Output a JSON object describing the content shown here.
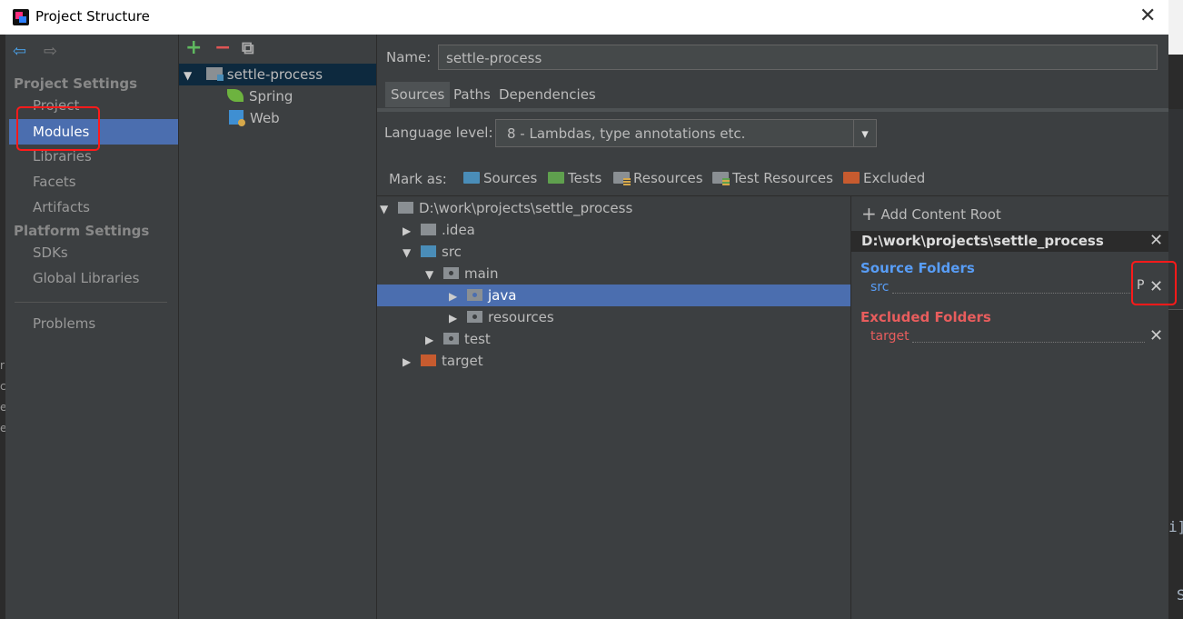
{
  "window": {
    "title": "Project Structure",
    "close_label": "✕"
  },
  "strip": {
    "right_text_1": "i]",
    "right_text_2": "S",
    "left_chars": [
      "r",
      "c",
      "e",
      "e"
    ]
  },
  "nav": {
    "back": "⇦",
    "forward": "⇨"
  },
  "sidebar": {
    "project_settings_label": "Project Settings",
    "platform_settings_label": "Platform Settings",
    "items_project": [
      "Project",
      "Modules",
      "Libraries",
      "Facets",
      "Artifacts"
    ],
    "items_platform": [
      "SDKs",
      "Global Libraries"
    ],
    "problems": "Problems",
    "selected": "Modules"
  },
  "module_toolbar": {
    "add": "+",
    "remove": "−",
    "copy": "⧉"
  },
  "modules": [
    {
      "name": "settle-process",
      "children": [
        "Spring",
        "Web"
      ]
    }
  ],
  "name_field": {
    "label": "Name:",
    "value": "settle-process"
  },
  "tabs": [
    "Sources",
    "Paths",
    "Dependencies"
  ],
  "active_tab": "Sources",
  "language_level": {
    "label": "Language level:",
    "value": "8 - Lambdas, type annotations etc.",
    "arrow": "▾"
  },
  "mark_as": {
    "label": "Mark as:",
    "items": [
      {
        "label": "Sources",
        "color": "#4a8db8"
      },
      {
        "label": "Tests",
        "color": "#5fa04e"
      },
      {
        "label": "Resources",
        "color": "#8a8f93"
      },
      {
        "label": "Test Resources",
        "color": "#8a8f93"
      },
      {
        "label": "Excluded",
        "color": "#c75b2f"
      }
    ]
  },
  "file_tree": {
    "root": "D:\\work\\projects\\settle_process",
    "idea": ".idea",
    "src": "src",
    "main": "main",
    "java": "java",
    "resources": "resources",
    "test": "test",
    "target": "target"
  },
  "content_root": {
    "add_label": "Add Content Root",
    "path": "D:\\work\\projects\\settle_process",
    "source_header": "Source Folders",
    "source_items": [
      "src"
    ],
    "source_prefix_label": "P",
    "excluded_header": "Excluded Folders",
    "excluded_items": [
      "target"
    ]
  },
  "colors": {
    "bg": "#3c3f41",
    "selection": "#4b6eaf",
    "source": "#589df6",
    "excluded": "#e85d5d",
    "annotation": "#ff1a1a"
  }
}
